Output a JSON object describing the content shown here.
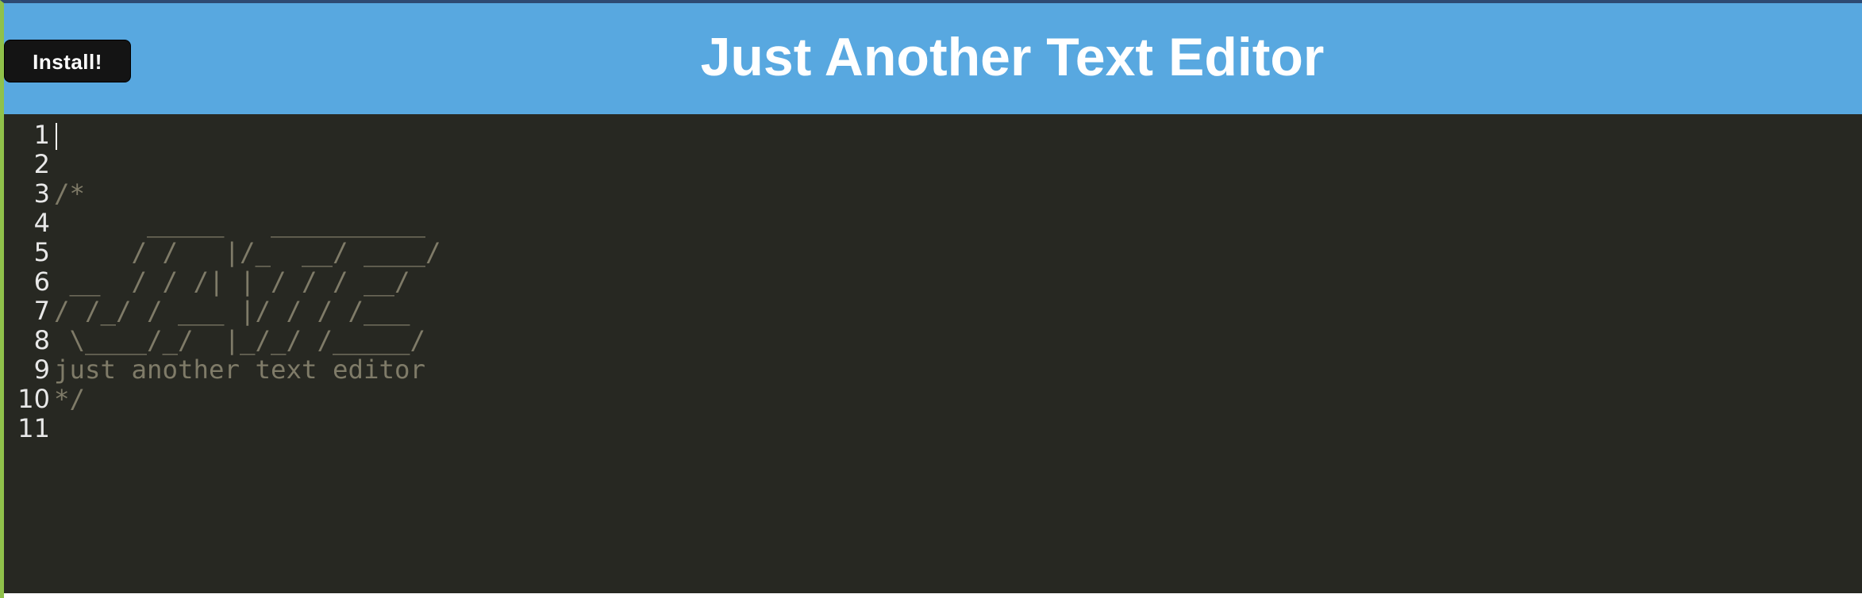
{
  "header": {
    "install_label": "Install!",
    "title": "Just Another Text Editor"
  },
  "editor": {
    "line_numbers": [
      "1",
      "2",
      "3",
      "4",
      "5",
      "6",
      "7",
      "8",
      "9",
      "10",
      "11"
    ],
    "lines": [
      "",
      "",
      "/*",
      "      _____   __________",
      "     / /   |/_  __/ ____/",
      " __  / / /| | / / / __/",
      "/ /_/ / ___ |/ / / /___",
      " \\____/_/  |_/_/ /_____/",
      "just another text editor",
      "*/",
      ""
    ]
  },
  "colors": {
    "header_bg": "#58a8e0",
    "editor_bg": "#272822",
    "comment": "#7f7b68",
    "line_number": "#e8e8e8",
    "button_bg": "#141414"
  }
}
